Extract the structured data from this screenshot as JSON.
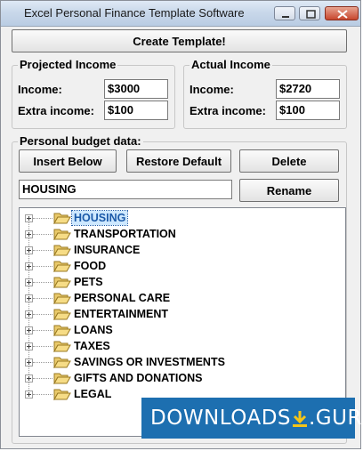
{
  "window": {
    "title": "Excel Personal Finance Template Software"
  },
  "toolbar": {
    "create_label": "Create Template!"
  },
  "projected": {
    "heading": "Projected Income",
    "income_label": "Income:",
    "income_value": "$3000",
    "extra_label": "Extra income:",
    "extra_value": "$100"
  },
  "actual": {
    "heading": "Actual Income",
    "income_label": "Income:",
    "income_value": "$2720",
    "extra_label": "Extra income:",
    "extra_value": "$100"
  },
  "budget": {
    "heading": "Personal budget data:",
    "insert_label": "Insert Below",
    "restore_label": "Restore Default",
    "delete_label": "Delete",
    "rename_label": "Rename",
    "edit_value": "HOUSING",
    "items": [
      {
        "label": "HOUSING",
        "selected": true
      },
      {
        "label": "TRANSPORTATION"
      },
      {
        "label": "INSURANCE"
      },
      {
        "label": "FOOD"
      },
      {
        "label": "PETS"
      },
      {
        "label": "PERSONAL CARE"
      },
      {
        "label": "ENTERTAINMENT"
      },
      {
        "label": "LOANS"
      },
      {
        "label": "TAXES"
      },
      {
        "label": "SAVINGS OR INVESTMENTS"
      },
      {
        "label": "GIFTS AND DONATIONS"
      },
      {
        "label": "LEGAL"
      }
    ]
  },
  "watermark": {
    "text": "DOWNLOADS",
    "suffix": ".GURU"
  },
  "icons": {
    "folder": "folder-open-icon",
    "expander": "plus-expander-icon",
    "download": "download-arrow-icon"
  }
}
